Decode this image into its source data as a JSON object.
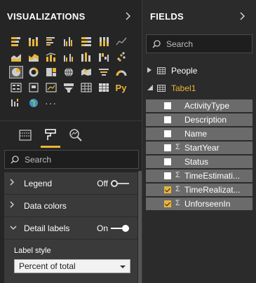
{
  "viz_panel": {
    "title": "VISUALIZATIONS",
    "icons": [
      "stacked-bar-icon",
      "stacked-column-icon",
      "clustered-bar-icon",
      "clustered-column-icon",
      "100-stacked-bar-icon",
      "100-stacked-column-icon",
      "line-chart-icon",
      "area-chart-icon",
      "stacked-area-icon",
      "line-column-icon",
      "line-clustered-column-icon",
      "ribbon-chart-icon",
      "waterfall-icon",
      "scatter-icon",
      "pie-chart-icon",
      "donut-chart-icon",
      "treemap-icon",
      "map-icon",
      "filled-map-icon",
      "funnel-icon",
      "gauge-icon",
      "multirow-card-icon",
      "card-icon",
      "kpi-icon",
      "slicer-icon",
      "table-icon",
      "matrix-icon",
      "python-visual-icon",
      "r-visual-icon",
      "globe-icon",
      "more-icon"
    ],
    "selected_icon_index": 14,
    "python_label": "Py",
    "more_label": "···",
    "search_placeholder": "Search",
    "cards": [
      {
        "label": "Legend",
        "state": "Off",
        "expanded": false
      },
      {
        "label": "Data colors",
        "state": "",
        "expanded": false
      },
      {
        "label": "Detail labels",
        "state": "On",
        "expanded": true
      }
    ],
    "label_style": {
      "title": "Label style",
      "value": "Percent of total"
    }
  },
  "fields_panel": {
    "title": "FIELDS",
    "search_placeholder": "Search",
    "tables": [
      {
        "name": "People",
        "expanded": false
      },
      {
        "name": "Tabel1",
        "expanded": true
      }
    ],
    "fields": [
      {
        "name": "ActivityType",
        "checked": false,
        "sigma": false
      },
      {
        "name": "Description",
        "checked": false,
        "sigma": false
      },
      {
        "name": "Name",
        "checked": false,
        "sigma": false
      },
      {
        "name": "StartYear",
        "checked": false,
        "sigma": true
      },
      {
        "name": "Status",
        "checked": false,
        "sigma": false
      },
      {
        "name": "TimeEstimati...",
        "checked": false,
        "sigma": true
      },
      {
        "name": "TimeRealizat...",
        "checked": true,
        "sigma": true
      },
      {
        "name": "UnforseenIn",
        "checked": true,
        "sigma": true
      }
    ]
  },
  "colors": {
    "accent": "#e8b53a",
    "panel_bg": "#252525",
    "card_bg": "#3a3a3a",
    "field_bg": "#6b6b6b"
  }
}
